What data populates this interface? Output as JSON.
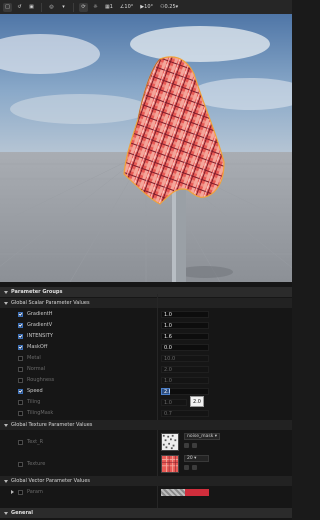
{
  "toolbar": {
    "zoom": "0.25",
    "fov_value": "10°",
    "rotate_value": "10°",
    "grid_value": "1"
  },
  "panel": {
    "parameter_groups": "Parameter Groups",
    "global_scalar": "Global Scalar Parameter Values",
    "global_texture": "Global Texture Parameter Values",
    "global_vector": "Global Vector Parameter Values",
    "general": "General"
  },
  "scalar_params": [
    {
      "name": "GradientH",
      "value": "1.0",
      "checked": true
    },
    {
      "name": "GradientV",
      "value": "1.0",
      "checked": true
    },
    {
      "name": "INTENSITY",
      "value": "1.6",
      "checked": true
    },
    {
      "name": "MaskOff",
      "value": "0.0",
      "checked": true
    },
    {
      "name": "Metal",
      "value": "10.0",
      "checked": false
    },
    {
      "name": "Normal",
      "value": "2.0",
      "checked": false
    },
    {
      "name": "Roughness",
      "value": "1.0",
      "checked": false
    },
    {
      "name": "Speed",
      "value": "2.0",
      "checked": true
    },
    {
      "name": "Tiling",
      "value": "1.0",
      "checked": false
    },
    {
      "name": "TilingMask",
      "value": "0.7",
      "checked": false
    }
  ],
  "tooltip": "2.0",
  "texture_params": [
    {
      "name": "Text_R",
      "asset": "noise_mask",
      "checked": false
    },
    {
      "name": "Texture",
      "asset": "20",
      "checked": false
    }
  ],
  "vector_params": [
    {
      "name": "Param",
      "color_a": "#bfbfbf",
      "color_b": "#d02e3c"
    }
  ]
}
